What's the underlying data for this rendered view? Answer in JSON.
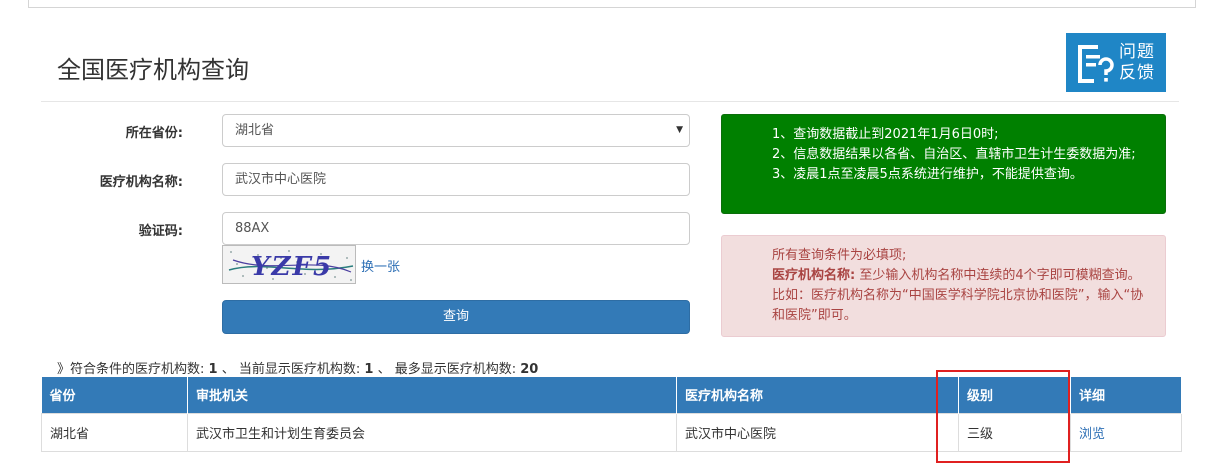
{
  "page": {
    "title": "全国医疗机构查询"
  },
  "feedback": {
    "line1": "问题",
    "line2": "反馈"
  },
  "form": {
    "province_label": "所在省份:",
    "province_value": "湖北省",
    "org_name_label": "医疗机构名称:",
    "org_name_value": "武汉市中心医院",
    "captcha_label": "验证码:",
    "captcha_value": "88AX",
    "captcha_image_text": "YZF5",
    "refresh_label": "换一张",
    "query_label": "查询"
  },
  "notice_green": {
    "line1": "1、查询数据截止到2021年1月6日0时;",
    "line2": "2、信息数据结果以各省、自治区、直辖市卫生计生委数据为准;",
    "line3": "3、凌晨1点至凌晨5点系统进行维护，不能提供查询。"
  },
  "notice_red": {
    "line1": "所有查询条件为必填项;",
    "bold_label": "医疗机构名称:",
    "rest": "至少输入机构名称中连续的4个字即可模糊查询。比如：医疗机构名称为“中国医学科学院北京协和医院”，输入“协和医院”即可。"
  },
  "summary": {
    "prefix": "》符合条件的医疗机构数:",
    "matched": "1",
    "mid": "、 当前显示医疗机构数:",
    "shown": "1",
    "mid2": "、 最多显示医疗机构数:",
    "max": "20"
  },
  "table": {
    "headers": [
      "省份",
      "审批机关",
      "医疗机构名称",
      "级别",
      "详细"
    ],
    "rows": [
      {
        "province": "湖北省",
        "authority": "武汉市卫生和计划生育委员会",
        "name": "武汉市中心医院",
        "level": "三级",
        "detail": "浏览"
      }
    ]
  },
  "colors": {
    "primary": "#337ab7",
    "notice_green": "#008000",
    "notice_red_bg": "#f2dede",
    "notice_red_text": "#a94442",
    "highlight": "#e02020"
  },
  "icons": {
    "feedback": "feedback-document-question-icon",
    "caret": "chevron-down-icon"
  }
}
